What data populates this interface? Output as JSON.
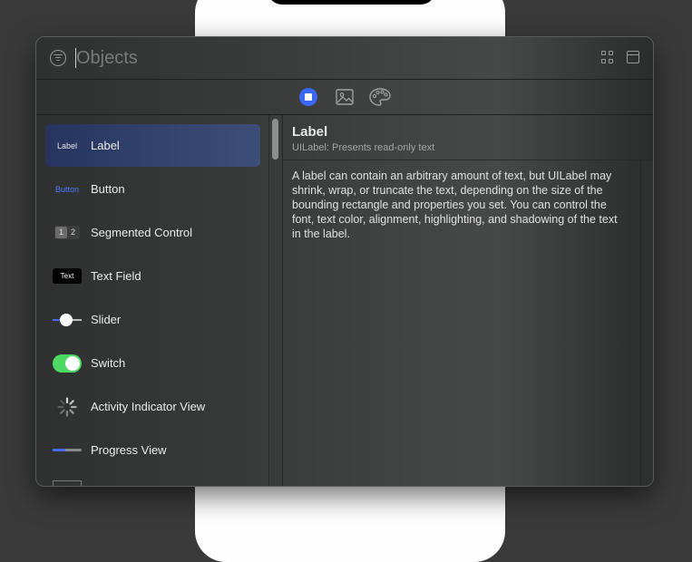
{
  "search": {
    "placeholder": "Objects",
    "value": ""
  },
  "tabs": [
    {
      "name": "objects",
      "icon": "square-in-circle-icon",
      "selected": true
    },
    {
      "name": "media",
      "icon": "photo-icon",
      "selected": false
    },
    {
      "name": "colors",
      "icon": "palette-icon",
      "selected": false
    }
  ],
  "library": {
    "items": [
      {
        "label": "Label",
        "icon": "label-icon",
        "icon_text": "Label",
        "selected": true
      },
      {
        "label": "Button",
        "icon": "button-icon",
        "icon_text": "Button"
      },
      {
        "label": "Segmented Control",
        "icon": "segmented-control-icon",
        "icon_text": [
          "1",
          "2"
        ]
      },
      {
        "label": "Text Field",
        "icon": "text-field-icon",
        "icon_text": "Text"
      },
      {
        "label": "Slider",
        "icon": "slider-icon",
        "level": 0.45
      },
      {
        "label": "Switch",
        "icon": "switch-icon",
        "on": true
      },
      {
        "label": "Activity Indicator View",
        "icon": "activity-indicator-icon"
      },
      {
        "label": "Progress View",
        "icon": "progress-view-icon",
        "progress": 0.45
      }
    ]
  },
  "detail": {
    "title": "Label",
    "subtitle": "UILabel: Presents read-only text",
    "description": "A label can contain an arbitrary amount of text, but UILabel may shrink, wrap, or truncate the text, depending on the size of the bounding rectangle and properties you set. You can control the font, text color, alignment, highlighting, and shadowing of the text in the label."
  },
  "colors": {
    "accent": "#3b67f5",
    "switch_on": "#4cd964",
    "selection": "#33456f"
  }
}
